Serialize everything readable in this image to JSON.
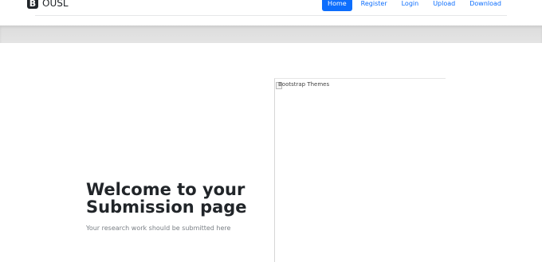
{
  "brand": {
    "logo_letter": "B",
    "name": "OUSL"
  },
  "nav": {
    "items": [
      {
        "label": "Home",
        "active": true
      },
      {
        "label": "Register"
      },
      {
        "label": "Login"
      },
      {
        "label": "Upload"
      },
      {
        "label": "Download"
      }
    ]
  },
  "hero": {
    "image_alt": "Bootstrap Themes",
    "title": "Welcome to your Submission page",
    "subtitle": "Your research work should be submitted here"
  },
  "colors": {
    "primary": "#0d6efd",
    "text": "#212529",
    "muted": "#7a7f85"
  }
}
